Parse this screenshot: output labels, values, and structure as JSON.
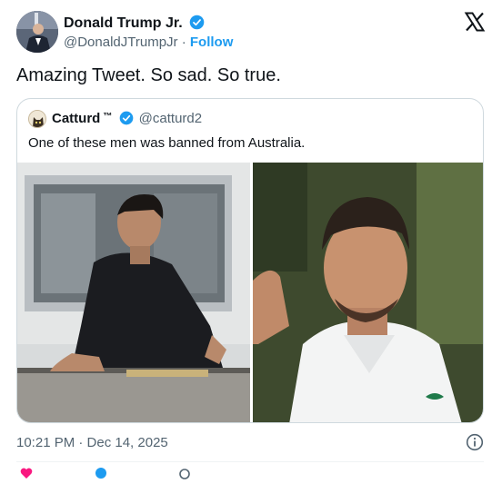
{
  "author": {
    "name": "Donald Trump Jr.",
    "handle": "@DonaldJTrumpJr",
    "separator": "·",
    "follow_label": "Follow"
  },
  "tweet": {
    "text": "Amazing Tweet. So sad. So true."
  },
  "quoted": {
    "name": "Catturd",
    "tm": "™",
    "handle": "@catturd2",
    "text": "One of these men was banned from Australia."
  },
  "meta": {
    "timestamp": "10:21 PM · Dec 14, 2025"
  },
  "icons": {
    "verified": "verified-badge-icon",
    "brand": "x-logo-icon",
    "info": "info-icon"
  },
  "colors": {
    "accent": "#1d9bf0",
    "text": "#0f1419",
    "secondary": "#536471",
    "border": "#cfd9de",
    "like": "#f91880"
  }
}
